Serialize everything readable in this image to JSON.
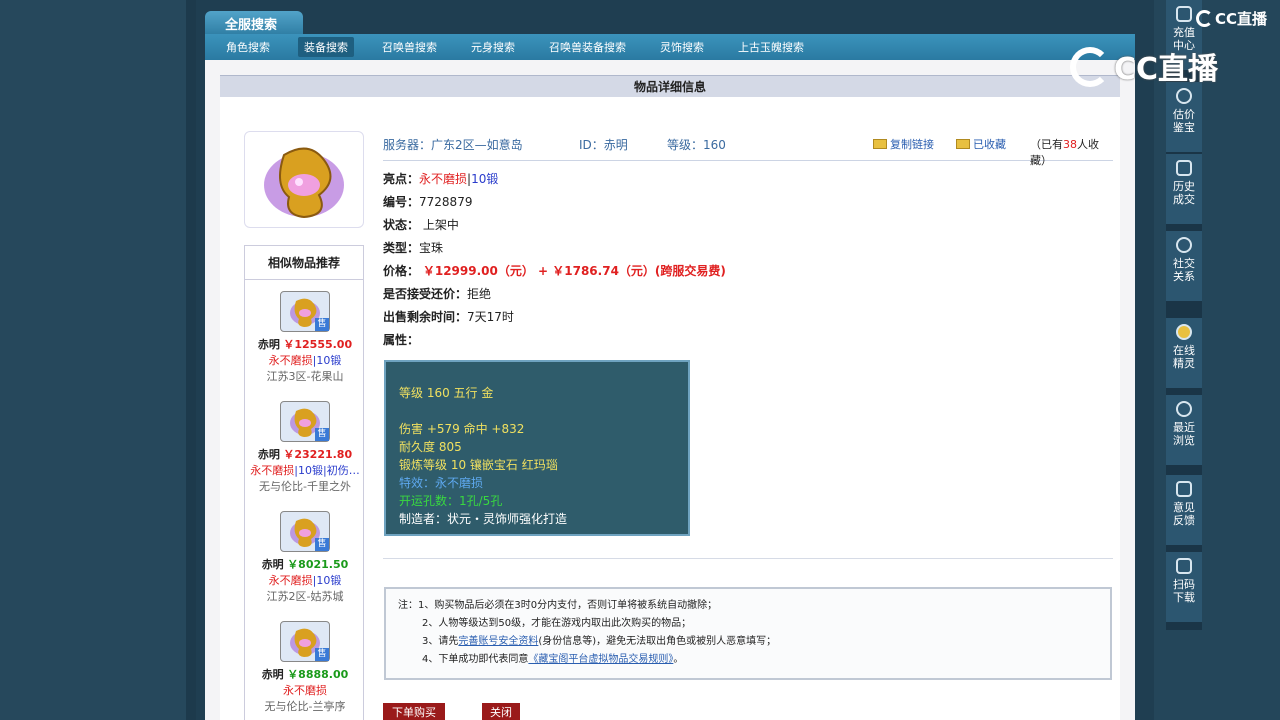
{
  "top_tab": "全服搜索",
  "nav": [
    "角色搜索",
    "装备搜索",
    "召唤兽搜索",
    "元身搜索",
    "召唤兽装备搜索",
    "灵饰搜索",
    "上古玉魄搜索"
  ],
  "detail_title": "物品详细信息",
  "header": {
    "server_label": "服务器：",
    "server": "广东2区—如意岛",
    "id_label": "ID：",
    "id": "赤明",
    "level_label": "等级：",
    "level": "160",
    "copy_link": "复制链接",
    "favorited": "已收藏",
    "fav_prefix": "（已有",
    "fav_count": "38",
    "fav_suffix": "人收藏）"
  },
  "info": {
    "highlight_label": "亮点：",
    "highlight_1": "永不磨损",
    "highlight_sep": "|",
    "highlight_2": "10锻",
    "number_label": "编号：",
    "number": "7728879",
    "status_label": "状态：",
    "status": "上架中",
    "type_label": "类型：",
    "type": "宝珠",
    "price_label": "价格：",
    "price": "￥12999.00（元） + ￥1786.74（元）(跨服交易费)",
    "counter_label": "是否接受还价：",
    "counter": "拒绝",
    "remain_label": "出售剩余时间：",
    "remain": "7天17时",
    "attr_label": "属性："
  },
  "attributes": {
    "line1": "等级 160 五行 金",
    "line2": "伤害 +579 命中 +832",
    "line3": "耐久度 805",
    "line4": "锻炼等级 10 镶嵌宝石 红玛瑙",
    "line5": "特效：永不磨损",
    "line6": "开运孔数：1孔/5孔",
    "line7": "制造者：状元・灵饰师强化打造"
  },
  "similar": {
    "title": "相似物品推荐",
    "items": [
      {
        "seller": "赤明",
        "price": "￥12555.00",
        "tags_red": "永不磨损",
        "tags_blue": "|10锻",
        "tags_more": "",
        "server": "江苏3区-花果山"
      },
      {
        "seller": "赤明",
        "price": "￥23221.80",
        "tags_red": "永不磨损",
        "tags_blue": "|10锻",
        "tags_more": "|初伤…",
        "server": "无与伦比-千里之外"
      },
      {
        "seller": "赤明",
        "price": "￥8021.50",
        "tags_red": "永不磨损",
        "tags_blue": "|10锻",
        "tags_more": "",
        "server": "江苏2区-姑苏城"
      },
      {
        "seller": "赤明",
        "price": "￥8888.00",
        "tags_red": "永不磨损",
        "tags_blue": "",
        "tags_more": "",
        "server": "无与伦比-兰亭序"
      }
    ],
    "sold_badge": "售"
  },
  "notes": {
    "n1": "注：1、购买物品后必须在3时0分内支付，否则订单将被系统自动撤除；",
    "n2": "2、人物等级达到50级，才能在游戏内取出此次购买的物品；",
    "n3_pre": "3、请先",
    "n3_link": "完善账号安全资料",
    "n3_post": "(身份信息等)，避免无法取出角色或被别人恶意填写；",
    "n4_pre": "4、下单成功即代表同意",
    "n4_link": "《藏宝阁平台虚拟物品交易规则》",
    "n4_post": "。"
  },
  "buttons": {
    "buy": "下单购买",
    "close": "关闭"
  },
  "sidebar": [
    {
      "l1": "充值",
      "l2": "中心"
    },
    {
      "l1": "估价",
      "l2": "鉴宝"
    },
    {
      "l1": "历史",
      "l2": "成交"
    },
    {
      "l1": "社交",
      "l2": "关系"
    },
    {
      "l1": "在线",
      "l2": "精灵"
    },
    {
      "l1": "最近",
      "l2": "浏览"
    },
    {
      "l1": "意见",
      "l2": "反馈"
    },
    {
      "l1": "扫码",
      "l2": "下载"
    }
  ],
  "watermark": {
    "small": "CC直播",
    "big": "CC直播"
  },
  "colors": {
    "price_red": "#e02020",
    "accent_blue": "#2a7aa2",
    "attr_bg": "#2f5c6b"
  }
}
